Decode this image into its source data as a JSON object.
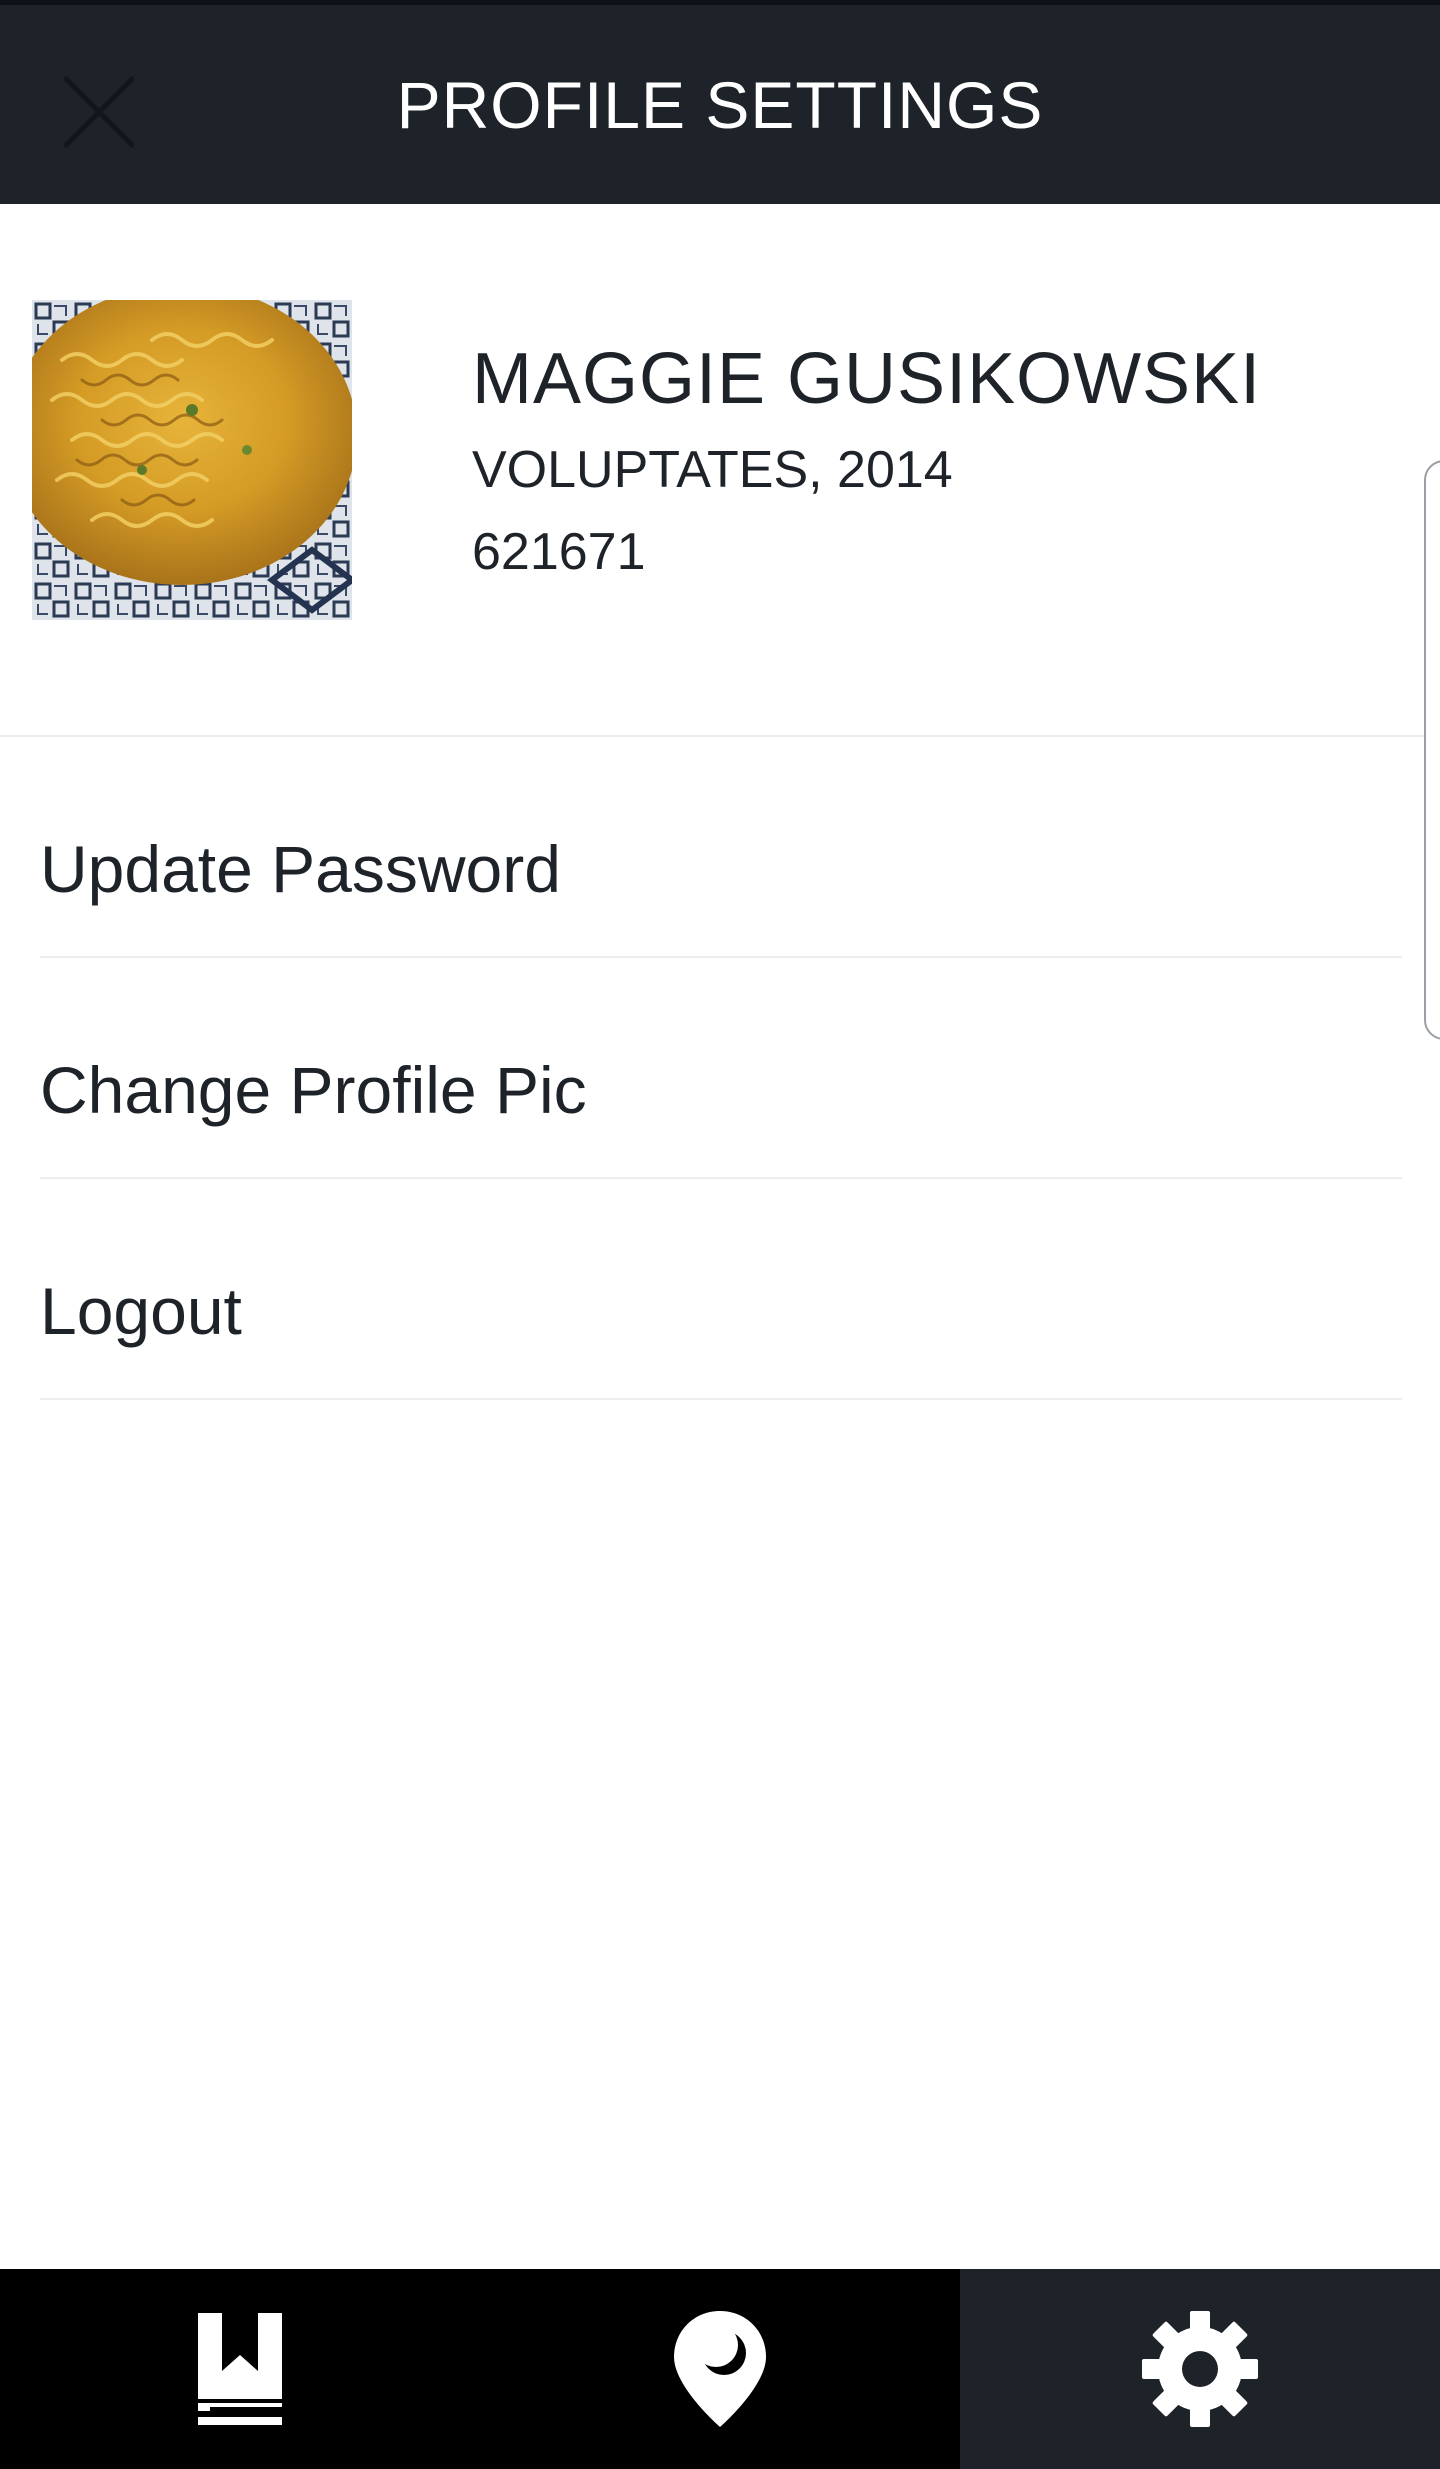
{
  "header": {
    "title": "PROFILE SETTINGS",
    "close_icon": "close-icon"
  },
  "profile": {
    "avatar_icon": "profile-photo",
    "name": "MAGGIE GUSIKOWSKI",
    "subtitle": "VOLUPTATES, 2014",
    "number": "621671"
  },
  "menu": {
    "items": [
      {
        "label": "Update Password"
      },
      {
        "label": "Change Profile Pic"
      },
      {
        "label": "Logout"
      }
    ]
  },
  "bottom_nav": {
    "items": [
      {
        "icon": "bookmark-book-icon",
        "active": false
      },
      {
        "icon": "location-pin-icon",
        "active": false
      },
      {
        "icon": "gear-icon",
        "active": true
      }
    ]
  },
  "colors": {
    "header_bg": "#1e232a",
    "nav_bg": "#000000",
    "nav_active_bg": "#1e232a",
    "text": "#1e2329",
    "divider": "#eceef1"
  }
}
